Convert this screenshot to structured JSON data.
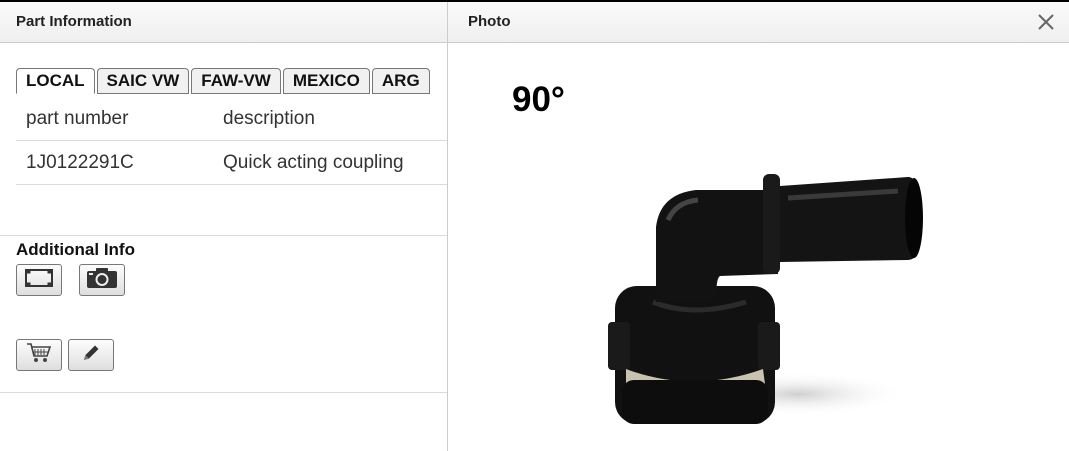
{
  "left_panel": {
    "title": "Part Information",
    "tabs": [
      {
        "label": "LOCAL",
        "active": true
      },
      {
        "label": "SAIC VW",
        "active": false
      },
      {
        "label": "FAW-VW",
        "active": false
      },
      {
        "label": "MEXICO",
        "active": false
      },
      {
        "label": "ARG",
        "active": false
      }
    ],
    "table": {
      "headers": [
        "part number",
        "description"
      ],
      "rows": [
        {
          "part_number": "1J0122291C",
          "description": "Quick acting coupling"
        }
      ]
    },
    "additional_info_label": "Additional Info",
    "icons": [
      "frame-icon",
      "camera-icon",
      "cart-icon",
      "pencil-icon"
    ]
  },
  "right_panel": {
    "title": "Photo",
    "angle_label": "90°",
    "close_icon": "close-icon"
  }
}
